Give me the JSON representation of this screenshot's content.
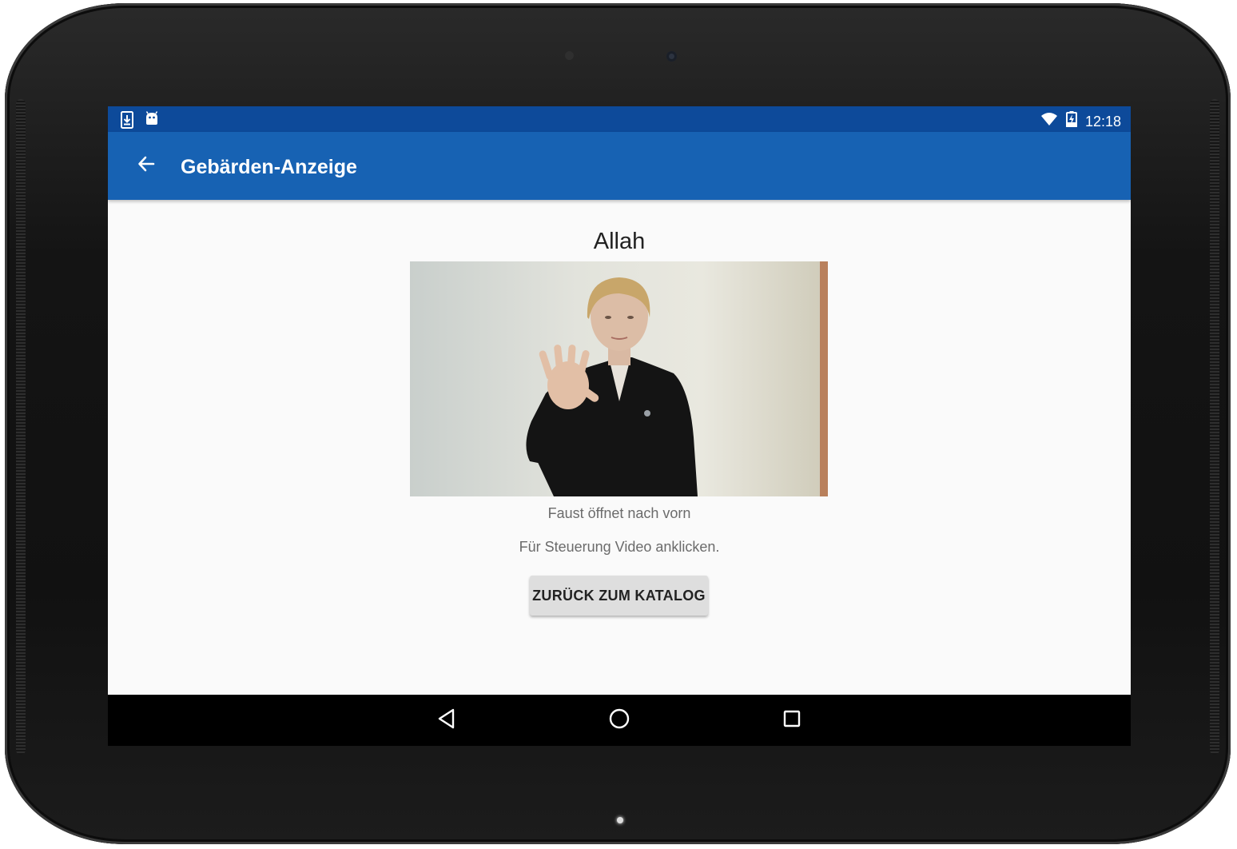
{
  "status_bar": {
    "time": "12:18",
    "left_icons": [
      "download-icon",
      "android-icon"
    ],
    "right_icons": [
      "wifi-icon",
      "battery-charging-icon"
    ]
  },
  "toolbar": {
    "back_icon": "arrow-back-icon",
    "title": "Gebärden-Anzeige",
    "background": "#1762b3"
  },
  "sign": {
    "word": "Allah",
    "description": "Faust öffnet nach vorn",
    "hint": "Für Steuerung Video anklicken."
  },
  "actions": {
    "back_to_catalog": "ZURÜCK ZUM KATALOG"
  },
  "nav_bar": {
    "buttons": [
      "back-triangle-icon",
      "home-circle-icon",
      "recents-square-icon"
    ]
  },
  "colors": {
    "status_bar": "#0d4a9a",
    "app_bar": "#1762b3",
    "content_bg": "#fafafa",
    "button_bg": "#dedede"
  }
}
